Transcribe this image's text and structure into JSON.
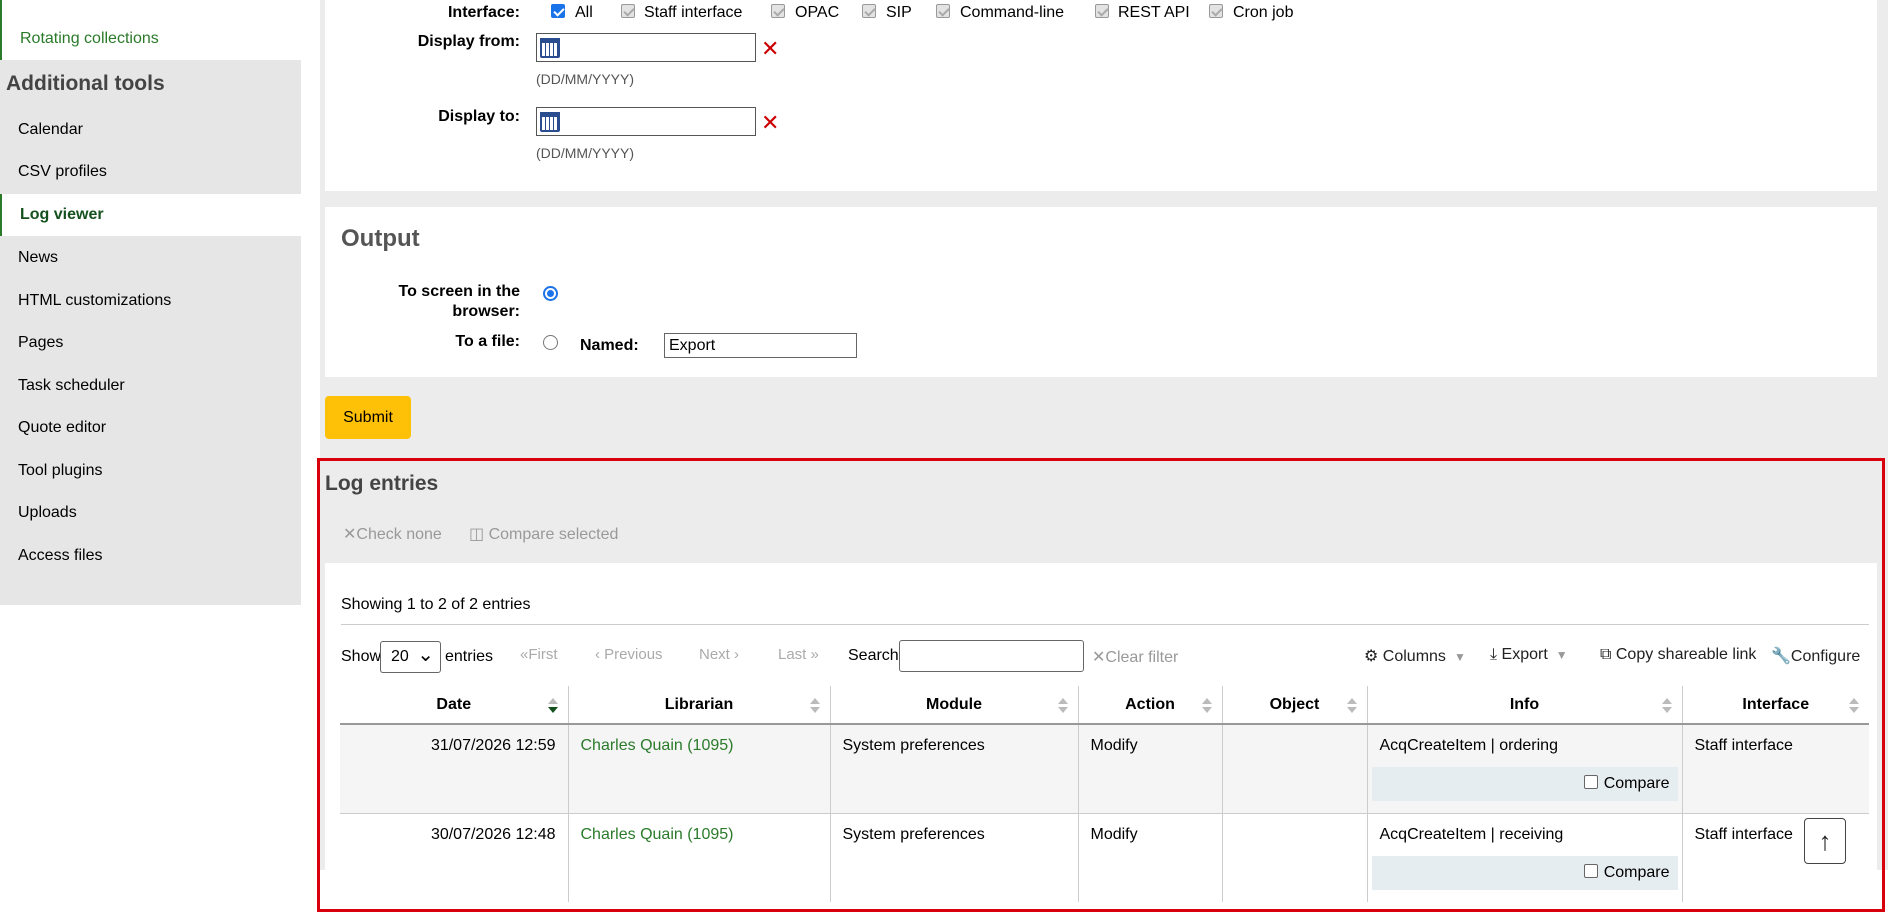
{
  "sidebar": {
    "top_item": "Rotating collections",
    "section_heading": "Additional tools",
    "items": [
      "Calendar",
      "CSV profiles",
      "Log viewer",
      "News",
      "HTML customizations",
      "Pages",
      "Task scheduler",
      "Quote editor",
      "Tool plugins",
      "Uploads",
      "Access files"
    ]
  },
  "filters": {
    "interface_label": "Interface:",
    "interfaces": [
      "All",
      "Staff interface",
      "OPAC",
      "SIP",
      "Command-line",
      "REST API",
      "Cron job"
    ],
    "display_from_label": "Display from:",
    "display_to_label": "Display to:",
    "date_hint": "(DD/MM/YYYY)"
  },
  "output": {
    "title": "Output",
    "to_screen_label_1": "To screen in the",
    "to_screen_label_2": "browser:",
    "to_file_label": "To a file:",
    "named_label": "Named:",
    "named_value": "Export",
    "submit_label": "Submit"
  },
  "log": {
    "title": "Log entries",
    "check_none": "Check none",
    "compare_selected": "Compare selected",
    "showing": "Showing 1 to 2 of 2 entries",
    "show_label": "Show",
    "page_size": "20",
    "entries_label": "entries",
    "pager": {
      "first": "First",
      "previous": "Previous",
      "next": "Next",
      "last": "Last"
    },
    "search_label": "Search:",
    "clear_filter": "Clear filter",
    "columns_btn": "Columns",
    "export_btn": "Export",
    "copy_link_btn": "Copy shareable link",
    "configure_btn": "Configure",
    "headers": [
      "Date",
      "Librarian",
      "Module",
      "Action",
      "Object",
      "Info",
      "Interface"
    ],
    "compare_label": "Compare",
    "rows": [
      {
        "date": "31/07/2026 12:59",
        "librarian": "Charles Quain (1095)",
        "module": "System preferences",
        "action": "Modify",
        "object": "",
        "info": "AcqCreateItem | ordering",
        "interface": "Staff interface"
      },
      {
        "date": "30/07/2026 12:48",
        "librarian": "Charles Quain (1095)",
        "module": "System preferences",
        "action": "Modify",
        "object": "",
        "info": "AcqCreateItem | receiving",
        "interface": "Staff interface"
      }
    ]
  },
  "colors": {
    "accent": "#2a7a2a",
    "submit": "#ffc107",
    "highlight": "#d9000d"
  }
}
